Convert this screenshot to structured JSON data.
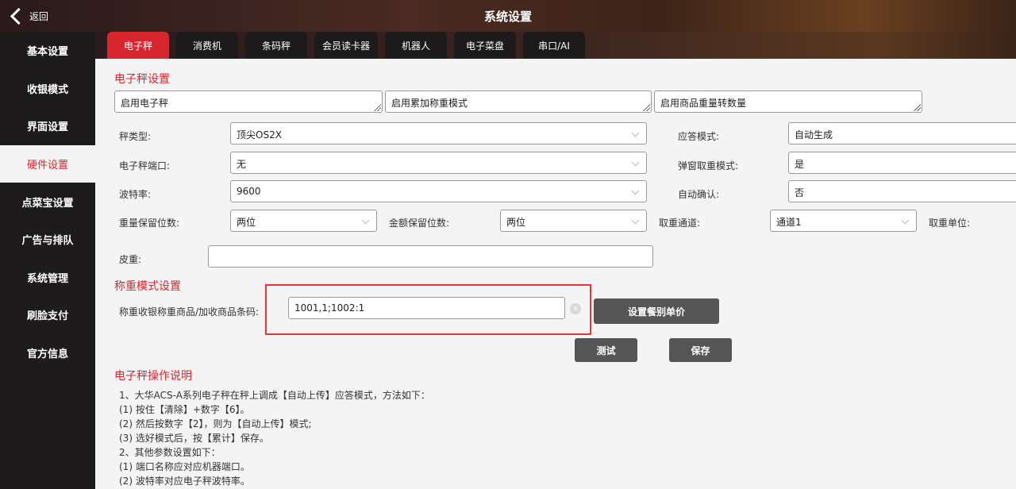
{
  "header": {
    "back_label": "返回",
    "title": "系统设置"
  },
  "sidebar": {
    "items": [
      {
        "label": "基本设置"
      },
      {
        "label": "收银模式"
      },
      {
        "label": "界面设置"
      },
      {
        "label": "硬件设置",
        "active": true
      },
      {
        "label": "点菜宝设置"
      },
      {
        "label": "广告与排队"
      },
      {
        "label": "系统管理"
      },
      {
        "label": "刷脸支付"
      },
      {
        "label": "官方信息"
      }
    ]
  },
  "tabs": [
    {
      "label": "电子秤",
      "active": true
    },
    {
      "label": "消费机"
    },
    {
      "label": "条码秤"
    },
    {
      "label": "会员读卡器"
    },
    {
      "label": "机器人"
    },
    {
      "label": "电子菜盘"
    },
    {
      "label": "串口/AI"
    }
  ],
  "scale": {
    "section_title": "电子秤设置",
    "toggles": [
      "启用电子秤",
      "启用累加称重模式",
      "启用商品重量转数量"
    ],
    "scale_type": {
      "label": "秤类型:",
      "value": "顶尖OS2X"
    },
    "answer_mode": {
      "label": "应答模式:",
      "value": "自动生成"
    },
    "port": {
      "label": "电子秤端口:",
      "value": "无"
    },
    "popup_mode": {
      "label": "弹窗取重模式:",
      "value": "是"
    },
    "baud": {
      "label": "波特率:",
      "value": "9600"
    },
    "auto_confirm": {
      "label": "自动确认:",
      "value": "否"
    },
    "weight_decimals": {
      "label": "重量保留位数:",
      "value": "两位"
    },
    "amount_decimals": {
      "label": "金额保留位数:",
      "value": "两位"
    },
    "channel": {
      "label": "取重通道:",
      "value": "通道1"
    },
    "unit": {
      "label": "取重单位:"
    },
    "tare": {
      "label": "皮重:",
      "value": ""
    }
  },
  "weigh_mode": {
    "section_title": "称重模式设置",
    "barcode_label": "称重收银称重商品/加收商品条码:",
    "barcode_value": "1001,1;1002:1",
    "clear_glyph": "x",
    "set_price_button": "设置餐别单价"
  },
  "actions": {
    "test": "测试",
    "save": "保存"
  },
  "instructions": {
    "title": "电子秤操作说明",
    "lines": [
      "1、大华ACS-A系列电子秤在秤上调成【自动上传】应答模式，方法如下：",
      "(1) 按住【清除】+数字【6】。",
      "(2) 然后按数字【2】，则为【自动上传】模式;",
      "(3) 选好模式后，按【累计】保存。",
      "2、其他参数设置如下：",
      "(1) 端口名称应对应机器端口。",
      "(2) 波特率对应电子秤波特率。"
    ]
  }
}
